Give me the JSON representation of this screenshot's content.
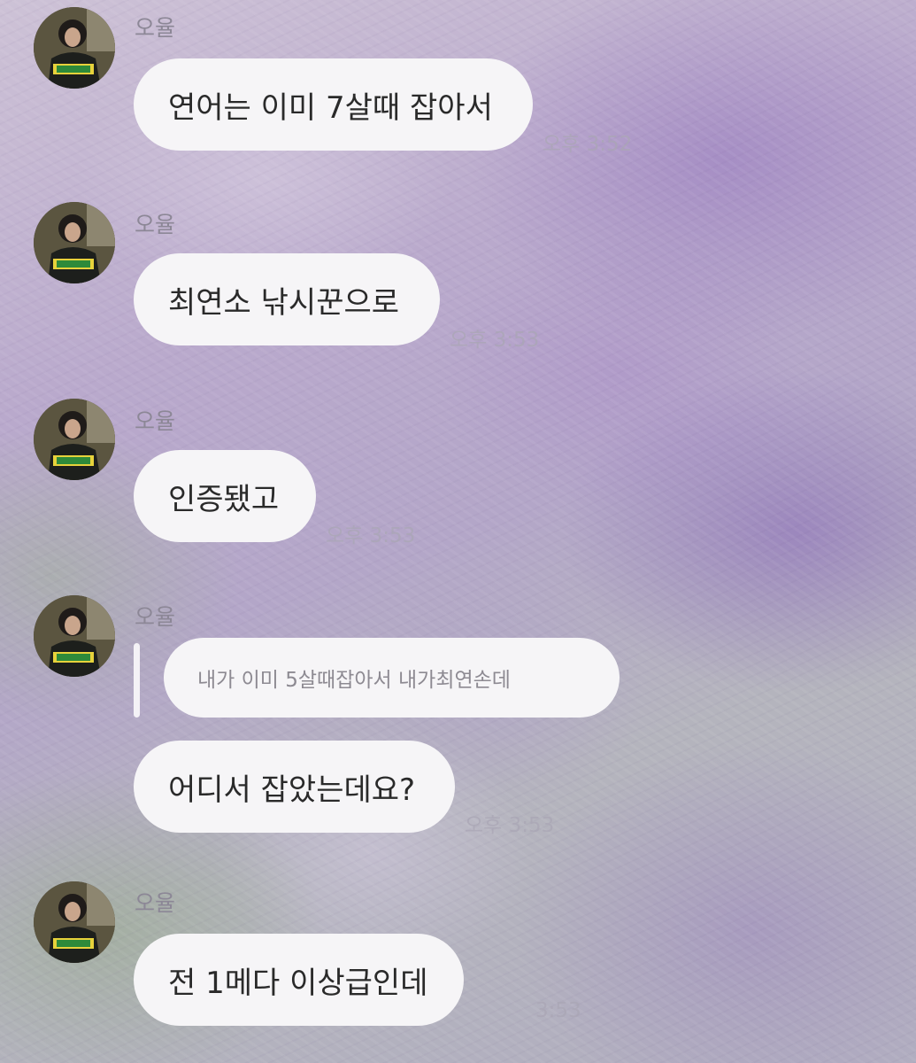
{
  "chat": {
    "messages": [
      {
        "sender": "오율",
        "text": "연어는 이미 7살때 잡아서",
        "time": "오후 3:52"
      },
      {
        "sender": "오율",
        "text": "최연소 낚시꾼으로",
        "time": "오후 3:53"
      },
      {
        "sender": "오율",
        "text": "인증됐고",
        "time": "오후 3:53"
      },
      {
        "sender": "오율",
        "reply_to": "내가 이미 5살때잡아서 내가최연손데",
        "text": "어디서 잡았는데요?",
        "time": "오후 3:53"
      },
      {
        "sender": "오율",
        "text": "전 1메다 이상급인데",
        "time": "3:53"
      }
    ]
  },
  "icons": {
    "avatar": "profile-photo-avatar"
  },
  "colors": {
    "bubble": "#f6f5f7",
    "sender_name": "#8c8796",
    "timestamp": "#aaa5b4",
    "background_accent": "#b9a9cc"
  }
}
